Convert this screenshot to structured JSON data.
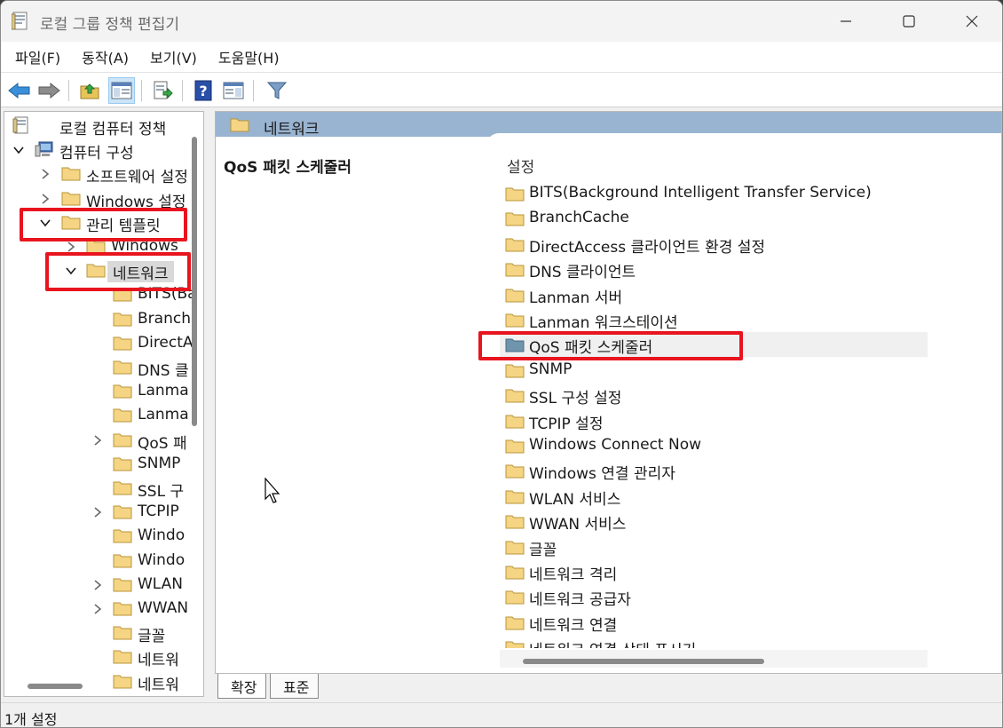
{
  "window": {
    "title": "로컬 그룹 정책 편집기"
  },
  "menu": [
    {
      "label": "파일(F)"
    },
    {
      "label": "동작(A)"
    },
    {
      "label": "보기(V)"
    },
    {
      "label": "도움말(H)"
    }
  ],
  "toolbar": {
    "items": [
      {
        "icon": "back-arrow-icon"
      },
      {
        "icon": "forward-arrow-icon"
      },
      {
        "icon": "up-folder-icon"
      },
      {
        "icon": "show-hide-console-tree-icon"
      },
      {
        "icon": "export-list-icon"
      },
      {
        "icon": "help-icon"
      },
      {
        "icon": "show-hide-action-pane-icon"
      },
      {
        "icon": "filter-icon"
      }
    ]
  },
  "tree": {
    "items": [
      {
        "label": "로컬 컴퓨터 정책",
        "indent": 0,
        "chevron": "none",
        "icon": "policy-document-icon"
      },
      {
        "label": "컴퓨터 구성",
        "indent": 1,
        "chevron": "down",
        "icon": "computer-icon"
      },
      {
        "label": "소프트웨어 설정",
        "indent": 2,
        "chevron": "right",
        "icon": "folder-icon"
      },
      {
        "label": "Windows 설정",
        "indent": 2,
        "chevron": "right",
        "icon": "folder-icon"
      },
      {
        "label": "관리 템플릿",
        "indent": 2,
        "chevron": "down",
        "icon": "folder-icon"
      },
      {
        "label": "Windows",
        "indent": 3,
        "chevron": "right",
        "icon": "folder-icon"
      },
      {
        "label": "네트워크",
        "indent": 3,
        "chevron": "down",
        "icon": "folder-open-icon",
        "selected": true
      },
      {
        "label": "BITS(Ba",
        "indent": 4,
        "chevron": "none",
        "icon": "folder-icon"
      },
      {
        "label": "Branch",
        "indent": 4,
        "chevron": "none",
        "icon": "folder-icon"
      },
      {
        "label": "DirectA",
        "indent": 4,
        "chevron": "none",
        "icon": "folder-icon"
      },
      {
        "label": "DNS 클",
        "indent": 4,
        "chevron": "none",
        "icon": "folder-icon"
      },
      {
        "label": "Lanma",
        "indent": 4,
        "chevron": "none",
        "icon": "folder-icon"
      },
      {
        "label": "Lanma",
        "indent": 4,
        "chevron": "none",
        "icon": "folder-icon"
      },
      {
        "label": "QoS 패",
        "indent": 4,
        "chevron": "right",
        "icon": "folder-icon"
      },
      {
        "label": "SNMP",
        "indent": 4,
        "chevron": "none",
        "icon": "folder-icon"
      },
      {
        "label": "SSL 구",
        "indent": 4,
        "chevron": "none",
        "icon": "folder-icon"
      },
      {
        "label": "TCPIP",
        "indent": 4,
        "chevron": "right",
        "icon": "folder-icon"
      },
      {
        "label": "Windo",
        "indent": 4,
        "chevron": "none",
        "icon": "folder-icon"
      },
      {
        "label": "Windo",
        "indent": 4,
        "chevron": "none",
        "icon": "folder-icon"
      },
      {
        "label": "WLAN",
        "indent": 4,
        "chevron": "right",
        "icon": "folder-icon"
      },
      {
        "label": "WWAN",
        "indent": 4,
        "chevron": "right",
        "icon": "folder-icon"
      },
      {
        "label": "글꼴",
        "indent": 4,
        "chevron": "none",
        "icon": "folder-icon"
      },
      {
        "label": "네트워",
        "indent": 4,
        "chevron": "none",
        "icon": "folder-icon"
      },
      {
        "label": "네트워",
        "indent": 4,
        "chevron": "none",
        "icon": "folder-icon"
      }
    ]
  },
  "main": {
    "header_title": "네트워크",
    "description_title": "QoS 패킷 스케줄러",
    "column_header": "설정",
    "items": [
      {
        "label": "BITS(Background Intelligent Transfer Service)"
      },
      {
        "label": "BranchCache"
      },
      {
        "label": "DirectAccess 클라이언트 환경 설정"
      },
      {
        "label": "DNS 클라이언트"
      },
      {
        "label": "Lanman 서버"
      },
      {
        "label": "Lanman 워크스테이션"
      },
      {
        "label": "QoS 패킷 스케줄러",
        "selected": true
      },
      {
        "label": "SNMP"
      },
      {
        "label": "SSL 구성 설정"
      },
      {
        "label": "TCPIP 설정"
      },
      {
        "label": "Windows Connect Now"
      },
      {
        "label": "Windows 연결 관리자"
      },
      {
        "label": "WLAN 서비스"
      },
      {
        "label": "WWAN 서비스"
      },
      {
        "label": "글꼴"
      },
      {
        "label": "네트워크 격리"
      },
      {
        "label": "네트워크 공급자"
      },
      {
        "label": "네트워크 연결"
      },
      {
        "label": "네트워크 연결 상태 표시기"
      }
    ]
  },
  "tabs": [
    {
      "label": "확장",
      "active": true
    },
    {
      "label": "표준",
      "active": false
    }
  ],
  "status": {
    "text": "1개 설정"
  },
  "colors": {
    "highlight": "#e8141e",
    "header_band": "#99b4d1",
    "folder": "#f5d584",
    "selected_folder": "#6f95ad"
  }
}
